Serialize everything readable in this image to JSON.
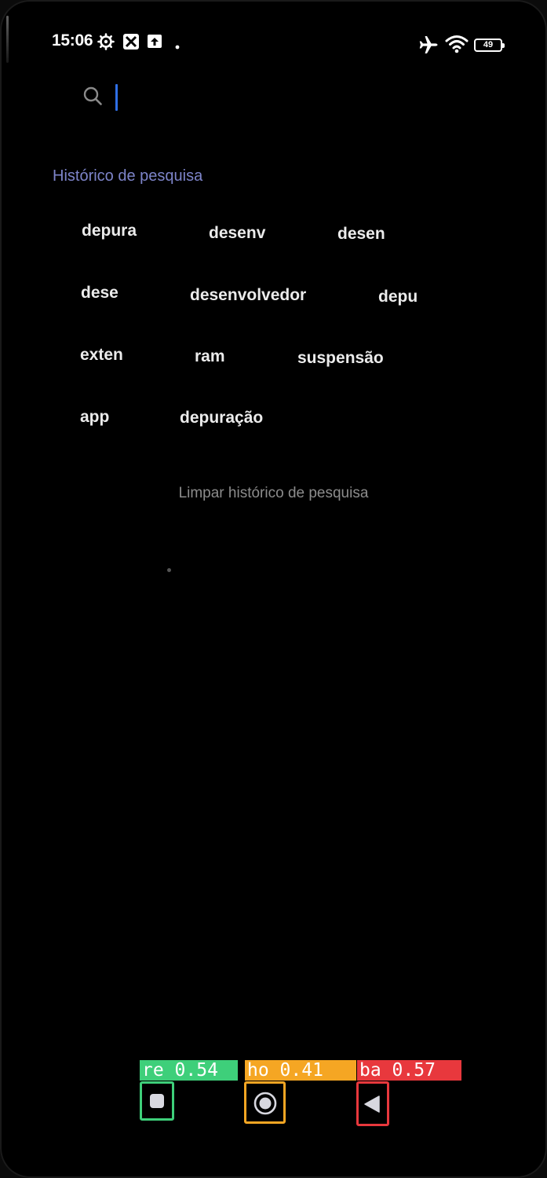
{
  "status_bar": {
    "time": "15:06",
    "icons": [
      "gear-icon",
      "x-app-icon",
      "upload-icon",
      "dot-icon"
    ],
    "right_icons": [
      "airplane-icon",
      "wifi-icon",
      "battery-icon"
    ],
    "battery_level": "49"
  },
  "search": {
    "value": "",
    "placeholder": "",
    "icon": "search-icon",
    "cursor_color": "#2f6fe6"
  },
  "history": {
    "title": "Histórico de pesquisa",
    "items": [
      "depura",
      "desenv",
      "desen",
      "dese",
      "desenvolvedor",
      "depu",
      "exten",
      "ram",
      "suspensão",
      "app",
      "depuração"
    ],
    "clear_label": "Limpar histórico de pesquisa"
  },
  "nav_bar": {
    "recents": {
      "tag": "re 0.54",
      "color": "#3ecf7a",
      "icon": "square-icon"
    },
    "home": {
      "tag": "ho 0.41",
      "color": "#f5a623",
      "icon": "circle-icon"
    },
    "back": {
      "tag": "ba 0.57",
      "color": "#e8383d",
      "icon": "triangle-back-icon"
    }
  },
  "colors": {
    "accent_title": "#7d84c9",
    "background": "#000000"
  }
}
